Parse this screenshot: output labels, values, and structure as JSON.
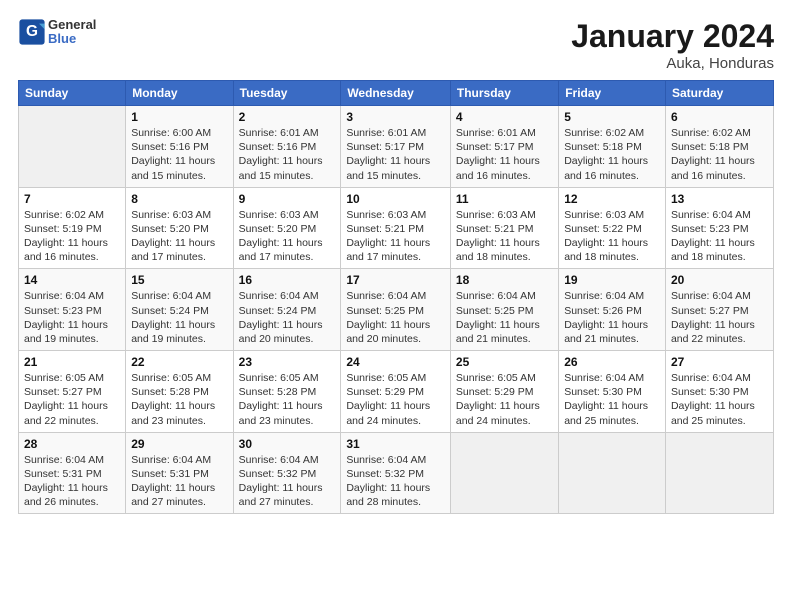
{
  "header": {
    "logo_general": "General",
    "logo_blue": "Blue",
    "month": "January 2024",
    "location": "Auka, Honduras"
  },
  "days_of_week": [
    "Sunday",
    "Monday",
    "Tuesday",
    "Wednesday",
    "Thursday",
    "Friday",
    "Saturday"
  ],
  "weeks": [
    [
      {
        "day": "",
        "info": ""
      },
      {
        "day": "1",
        "info": "Sunrise: 6:00 AM\nSunset: 5:16 PM\nDaylight: 11 hours\nand 15 minutes."
      },
      {
        "day": "2",
        "info": "Sunrise: 6:01 AM\nSunset: 5:16 PM\nDaylight: 11 hours\nand 15 minutes."
      },
      {
        "day": "3",
        "info": "Sunrise: 6:01 AM\nSunset: 5:17 PM\nDaylight: 11 hours\nand 15 minutes."
      },
      {
        "day": "4",
        "info": "Sunrise: 6:01 AM\nSunset: 5:17 PM\nDaylight: 11 hours\nand 16 minutes."
      },
      {
        "day": "5",
        "info": "Sunrise: 6:02 AM\nSunset: 5:18 PM\nDaylight: 11 hours\nand 16 minutes."
      },
      {
        "day": "6",
        "info": "Sunrise: 6:02 AM\nSunset: 5:18 PM\nDaylight: 11 hours\nand 16 minutes."
      }
    ],
    [
      {
        "day": "7",
        "info": "Sunrise: 6:02 AM\nSunset: 5:19 PM\nDaylight: 11 hours\nand 16 minutes."
      },
      {
        "day": "8",
        "info": "Sunrise: 6:03 AM\nSunset: 5:20 PM\nDaylight: 11 hours\nand 17 minutes."
      },
      {
        "day": "9",
        "info": "Sunrise: 6:03 AM\nSunset: 5:20 PM\nDaylight: 11 hours\nand 17 minutes."
      },
      {
        "day": "10",
        "info": "Sunrise: 6:03 AM\nSunset: 5:21 PM\nDaylight: 11 hours\nand 17 minutes."
      },
      {
        "day": "11",
        "info": "Sunrise: 6:03 AM\nSunset: 5:21 PM\nDaylight: 11 hours\nand 18 minutes."
      },
      {
        "day": "12",
        "info": "Sunrise: 6:03 AM\nSunset: 5:22 PM\nDaylight: 11 hours\nand 18 minutes."
      },
      {
        "day": "13",
        "info": "Sunrise: 6:04 AM\nSunset: 5:23 PM\nDaylight: 11 hours\nand 18 minutes."
      }
    ],
    [
      {
        "day": "14",
        "info": "Sunrise: 6:04 AM\nSunset: 5:23 PM\nDaylight: 11 hours\nand 19 minutes."
      },
      {
        "day": "15",
        "info": "Sunrise: 6:04 AM\nSunset: 5:24 PM\nDaylight: 11 hours\nand 19 minutes."
      },
      {
        "day": "16",
        "info": "Sunrise: 6:04 AM\nSunset: 5:24 PM\nDaylight: 11 hours\nand 20 minutes."
      },
      {
        "day": "17",
        "info": "Sunrise: 6:04 AM\nSunset: 5:25 PM\nDaylight: 11 hours\nand 20 minutes."
      },
      {
        "day": "18",
        "info": "Sunrise: 6:04 AM\nSunset: 5:25 PM\nDaylight: 11 hours\nand 21 minutes."
      },
      {
        "day": "19",
        "info": "Sunrise: 6:04 AM\nSunset: 5:26 PM\nDaylight: 11 hours\nand 21 minutes."
      },
      {
        "day": "20",
        "info": "Sunrise: 6:04 AM\nSunset: 5:27 PM\nDaylight: 11 hours\nand 22 minutes."
      }
    ],
    [
      {
        "day": "21",
        "info": "Sunrise: 6:05 AM\nSunset: 5:27 PM\nDaylight: 11 hours\nand 22 minutes."
      },
      {
        "day": "22",
        "info": "Sunrise: 6:05 AM\nSunset: 5:28 PM\nDaylight: 11 hours\nand 23 minutes."
      },
      {
        "day": "23",
        "info": "Sunrise: 6:05 AM\nSunset: 5:28 PM\nDaylight: 11 hours\nand 23 minutes."
      },
      {
        "day": "24",
        "info": "Sunrise: 6:05 AM\nSunset: 5:29 PM\nDaylight: 11 hours\nand 24 minutes."
      },
      {
        "day": "25",
        "info": "Sunrise: 6:05 AM\nSunset: 5:29 PM\nDaylight: 11 hours\nand 24 minutes."
      },
      {
        "day": "26",
        "info": "Sunrise: 6:04 AM\nSunset: 5:30 PM\nDaylight: 11 hours\nand 25 minutes."
      },
      {
        "day": "27",
        "info": "Sunrise: 6:04 AM\nSunset: 5:30 PM\nDaylight: 11 hours\nand 25 minutes."
      }
    ],
    [
      {
        "day": "28",
        "info": "Sunrise: 6:04 AM\nSunset: 5:31 PM\nDaylight: 11 hours\nand 26 minutes."
      },
      {
        "day": "29",
        "info": "Sunrise: 6:04 AM\nSunset: 5:31 PM\nDaylight: 11 hours\nand 27 minutes."
      },
      {
        "day": "30",
        "info": "Sunrise: 6:04 AM\nSunset: 5:32 PM\nDaylight: 11 hours\nand 27 minutes."
      },
      {
        "day": "31",
        "info": "Sunrise: 6:04 AM\nSunset: 5:32 PM\nDaylight: 11 hours\nand 28 minutes."
      },
      {
        "day": "",
        "info": ""
      },
      {
        "day": "",
        "info": ""
      },
      {
        "day": "",
        "info": ""
      }
    ]
  ]
}
